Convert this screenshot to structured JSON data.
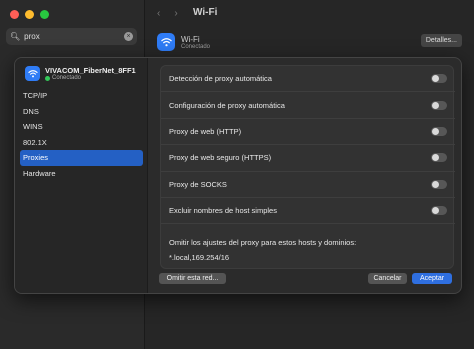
{
  "search": {
    "value": "prox"
  },
  "background": {
    "title": "Wi-Fi",
    "wifi_name": "Wi-Fi",
    "wifi_status": "Conectado",
    "details_button": "Detalles..."
  },
  "network": {
    "name": "VIVACOM_FiberNet_8FF1",
    "status": "Conectado"
  },
  "sidebar": {
    "items": [
      {
        "label": "TCP/IP"
      },
      {
        "label": "DNS"
      },
      {
        "label": "WINS"
      },
      {
        "label": "802.1X"
      },
      {
        "label": "Proxies",
        "active": true
      },
      {
        "label": "Hardware"
      }
    ]
  },
  "options": [
    {
      "label": "Detección de proxy automática",
      "enabled": false
    },
    {
      "label": "Configuración de proxy automática",
      "enabled": false
    },
    {
      "label": "Proxy de web (HTTP)",
      "enabled": false
    },
    {
      "label": "Proxy de web seguro (HTTPS)",
      "enabled": false
    },
    {
      "label": "Proxy de SOCKS",
      "enabled": false
    },
    {
      "label": "Excluir nombres de host simples",
      "enabled": false
    }
  ],
  "bypass": {
    "label": "Omitir los ajustes del proxy para estos hosts y dominios:",
    "value": "*.local,169.254/16"
  },
  "buttons": {
    "omit": "Omitir esta red...",
    "cancel": "Cancelar",
    "accept": "Aceptar"
  },
  "colors": {
    "accent": "#2f6fe0",
    "status_green": "#34c759"
  }
}
